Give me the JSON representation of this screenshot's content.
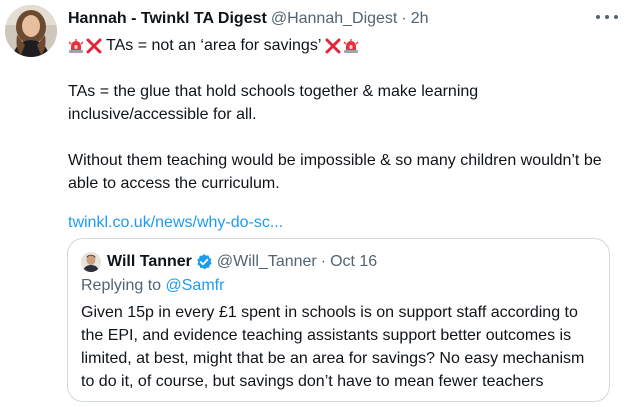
{
  "tweet": {
    "author_name": "Hannah - Twinkl TA Digest",
    "author_handle": "@Hannah_Digest",
    "separator": "·",
    "time": "2h",
    "headline": "TAs = not an ‘area for savings’",
    "paragraph1": "TAs = the glue that hold schools together & make learning inclusive/accessible for all.",
    "paragraph2": "Without them teaching would be impossible & so many children wouldn’t be able to access the curriculum.",
    "link": "twinkl.co.uk/news/why-do-sc...",
    "icons": {
      "more": "more-dots-icon",
      "siren": "police-light-emoji",
      "cross": "cross-mark-emoji",
      "verified": "verified-badge-icon"
    },
    "colors": {
      "link": "#1d9bf0",
      "secondary": "#536471",
      "border": "#cfd9de",
      "verified": "#1d9bf0"
    }
  },
  "quoted": {
    "author_name": "Will Tanner",
    "author_handle": "@Will_Tanner",
    "separator": "·",
    "date": "Oct 16",
    "replying_prefix": "Replying to",
    "replying_to": "@Samfr",
    "text": "Given 15p in every £1 spent in schools is on support staff according to the EPI, and evidence teaching assistants support better outcomes is limited, at best, might that be an area for savings? No easy mechanism to do it, of course, but savings don’t have to mean fewer teachers"
  }
}
